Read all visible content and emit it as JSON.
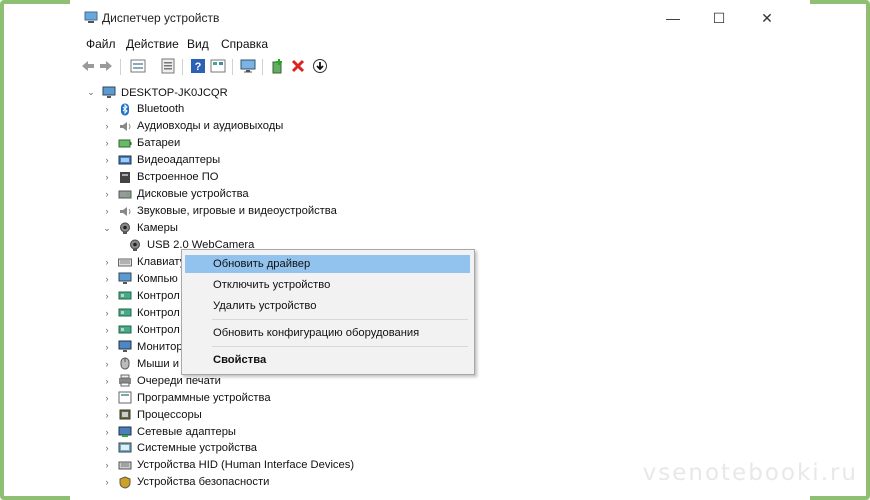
{
  "window": {
    "title": "Диспетчер устройств",
    "controls": {
      "minimize": "—",
      "maximize": "☐",
      "close": "✕"
    }
  },
  "menu": [
    "Файл",
    "Действие",
    "Вид",
    "Справка"
  ],
  "toolbar": {
    "icons": [
      "back-icon",
      "forward-icon",
      "properties-icon",
      "view-icon",
      "help-icon",
      "view2-icon",
      "monitor-icon",
      "add-driver-icon",
      "uninstall-icon",
      "update-icon"
    ]
  },
  "tree": {
    "root": "DESKTOP-JK0JCQR",
    "items": [
      {
        "label": "Bluetooth",
        "icon": "bluetooth-icon",
        "expanded": false
      },
      {
        "label": "Аудиовходы и аудиовыходы",
        "icon": "speaker-icon",
        "expanded": false
      },
      {
        "label": "Батареи",
        "icon": "battery-icon",
        "expanded": false
      },
      {
        "label": "Видеоадаптеры",
        "icon": "display-adapter-icon",
        "expanded": false
      },
      {
        "label": "Встроенное ПО",
        "icon": "firmware-icon",
        "expanded": false
      },
      {
        "label": "Дисковые устройства",
        "icon": "disk-icon",
        "expanded": false
      },
      {
        "label": "Звуковые, игровые и видеоустройства",
        "icon": "speaker-icon",
        "expanded": false
      },
      {
        "label": "Камеры",
        "icon": "camera-icon",
        "expanded": true
      },
      {
        "label": "USB 2.0 WebCamera",
        "icon": "camera-icon",
        "child": true
      },
      {
        "label": "Клавиату",
        "icon": "keyboard-icon",
        "expanded": false
      },
      {
        "label": "Компью",
        "icon": "computer-icon",
        "expanded": false
      },
      {
        "label": "Контрол",
        "icon": "controller-icon",
        "expanded": false
      },
      {
        "label": "Контрол",
        "icon": "controller-icon",
        "expanded": false
      },
      {
        "label": "Контрол",
        "icon": "controller-icon",
        "expanded": false
      },
      {
        "label": "Монитор",
        "icon": "monitor-icon",
        "expanded": false
      },
      {
        "label": "Мыши и",
        "icon": "mouse-icon",
        "expanded": false
      },
      {
        "label": "Очереди печати",
        "icon": "printer-icon",
        "expanded": false
      },
      {
        "label": "Программные устройства",
        "icon": "software-device-icon",
        "expanded": false
      },
      {
        "label": "Процессоры",
        "icon": "cpu-icon",
        "expanded": false
      },
      {
        "label": "Сетевые адаптеры",
        "icon": "network-icon",
        "expanded": false
      },
      {
        "label": "Системные устройства",
        "icon": "system-icon",
        "expanded": false
      },
      {
        "label": "Устройства HID (Human Interface Devices)",
        "icon": "hid-icon",
        "expanded": false
      },
      {
        "label": "Устройства безопасности",
        "icon": "security-icon",
        "expanded": false
      }
    ]
  },
  "context_menu": {
    "items": [
      {
        "label": "Обновить драйвер",
        "highlighted": true
      },
      {
        "label": "Отключить устройство"
      },
      {
        "label": "Удалить устройство"
      },
      {
        "label": "Обновить конфигурацию оборудования"
      },
      {
        "label": "Свойства",
        "bold": true
      }
    ]
  },
  "watermark": "vsenotebooki.ru",
  "colors": {
    "frame": "#8fbf72",
    "highlight": "#92c3ee"
  }
}
